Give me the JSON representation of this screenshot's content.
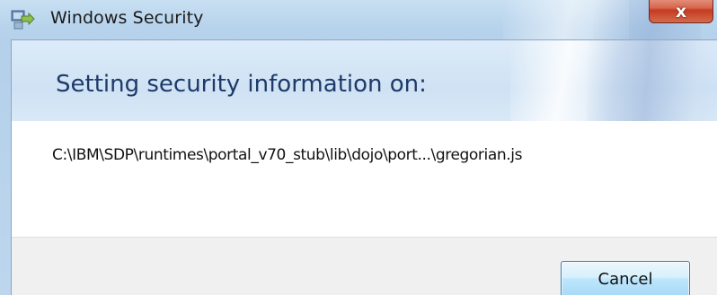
{
  "window": {
    "title": "Windows Security",
    "close_label": "x"
  },
  "dialog": {
    "heading": "Setting security information on:",
    "path": "C:\\IBM\\SDP\\runtimes\\portal_v70_stub\\lib\\dojo\\port...\\gregorian.js"
  },
  "buttons": {
    "cancel_label": "Cancel"
  },
  "icons": {
    "app": "security-shield-arrow-icon"
  },
  "colors": {
    "heading_text": "#1e3a68",
    "close_button": "#c43c22",
    "cancel_button_border": "#3c7fb1"
  }
}
